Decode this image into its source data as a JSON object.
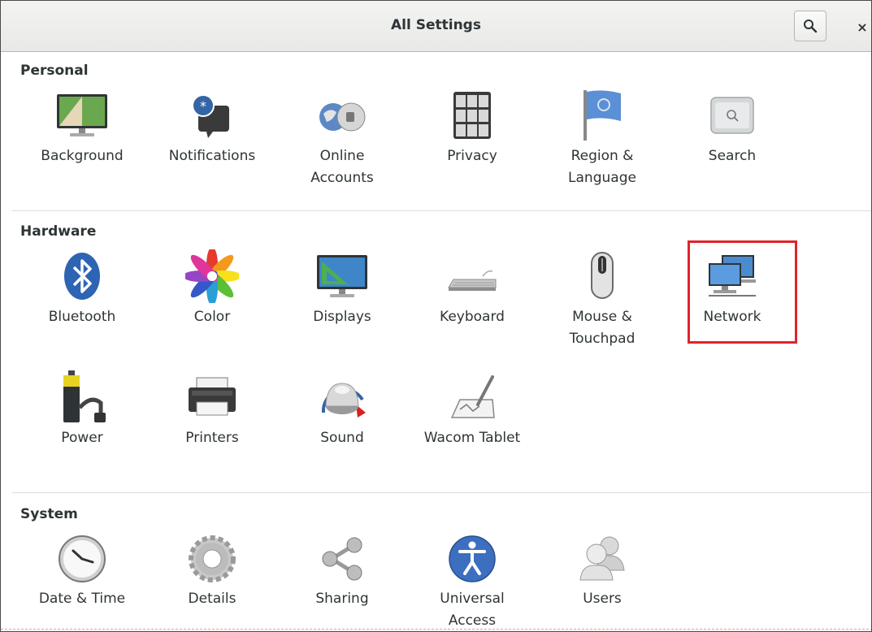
{
  "window": {
    "title": "All Settings"
  },
  "header": {
    "search_icon": "search-icon",
    "close_glyph": "×"
  },
  "sections": {
    "personal": {
      "title": "Personal",
      "items": [
        {
          "label": "Background",
          "icon": "background-icon"
        },
        {
          "label": "Notifications",
          "icon": "notifications-icon"
        },
        {
          "label": "Online\nAccounts",
          "icon": "online-accounts-icon"
        },
        {
          "label": "Privacy",
          "icon": "privacy-icon"
        },
        {
          "label": "Region &\nLanguage",
          "icon": "region-language-icon"
        },
        {
          "label": "Search",
          "icon": "search-settings-icon"
        }
      ]
    },
    "hardware": {
      "title": "Hardware",
      "items": [
        {
          "label": "Bluetooth",
          "icon": "bluetooth-icon"
        },
        {
          "label": "Color",
          "icon": "color-icon"
        },
        {
          "label": "Displays",
          "icon": "displays-icon"
        },
        {
          "label": "Keyboard",
          "icon": "keyboard-icon"
        },
        {
          "label": "Mouse &\nTouchpad",
          "icon": "mouse-icon"
        },
        {
          "label": "Network",
          "icon": "network-icon"
        },
        {
          "label": "Power",
          "icon": "power-icon"
        },
        {
          "label": "Printers",
          "icon": "printers-icon"
        },
        {
          "label": "Sound",
          "icon": "sound-icon"
        },
        {
          "label": "Wacom Tablet",
          "icon": "wacom-tablet-icon"
        }
      ]
    },
    "system": {
      "title": "System",
      "items": [
        {
          "label": "Date & Time",
          "icon": "date-time-icon"
        },
        {
          "label": "Details",
          "icon": "details-icon"
        },
        {
          "label": "Sharing",
          "icon": "sharing-icon"
        },
        {
          "label": "Universal\nAccess",
          "icon": "universal-access-icon"
        },
        {
          "label": "Users",
          "icon": "users-icon"
        }
      ]
    }
  },
  "colors": {
    "highlight": "#e0232b",
    "accent_blue": "#3465a4"
  }
}
